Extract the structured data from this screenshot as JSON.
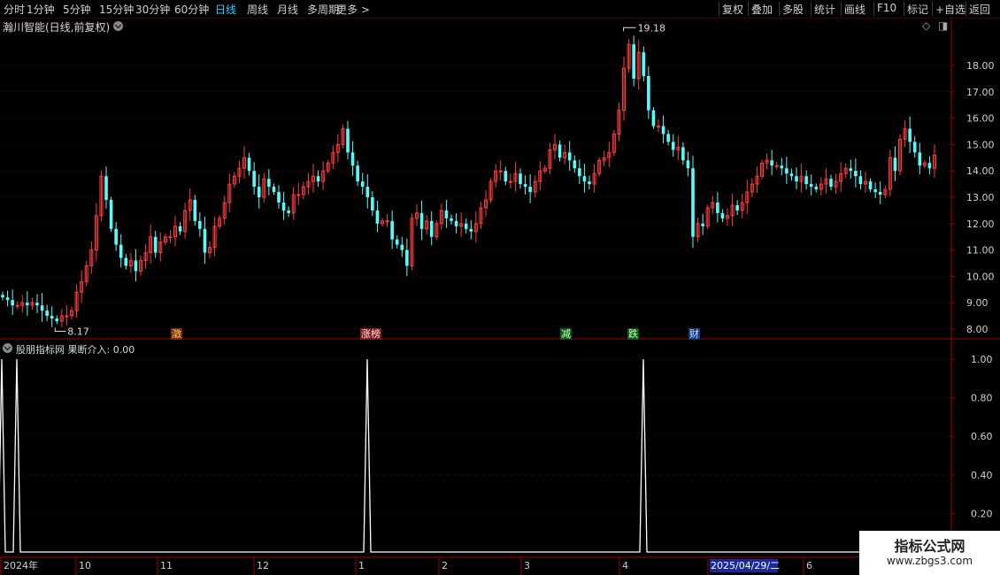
{
  "toolbar": {
    "periods": [
      "分时",
      "1分钟",
      "5分钟",
      "15分钟",
      "30分钟",
      "60分钟",
      "日线",
      "周线",
      "月线",
      "多周期",
      "更多 >"
    ],
    "active_period": "日线",
    "actions": [
      "复权",
      "叠加",
      "多股",
      "统计",
      "画线",
      "F10",
      "标记",
      "+自选",
      "返回"
    ]
  },
  "stock": {
    "title": "瀚川智能(日线,前复权)",
    "high_label": "19.18",
    "low_label": "8.17"
  },
  "price_axis": [
    "18.00",
    "17.00",
    "16.00",
    "15.00",
    "14.00",
    "13.00",
    "12.00",
    "11.00",
    "10.00",
    "9.00",
    "8.00"
  ],
  "indicator": {
    "title": "股朋指标网 果断介入: 0.00",
    "axis": [
      "1.00",
      "0.80",
      "0.60",
      "0.40",
      "0.20"
    ]
  },
  "events": [
    "澂",
    "涨榜",
    "减",
    "跌",
    "财"
  ],
  "date_axis": {
    "labels": [
      "2024年",
      "10",
      "11",
      "12",
      "1",
      "2",
      "3",
      "4",
      "2025/04/29/二",
      "6"
    ]
  },
  "watermark": {
    "line1": "指标公式网",
    "line2": "www.zbgs3.com"
  },
  "colors": {
    "up": "#ff3c3c",
    "down": "#54fcfc",
    "grid": "#5a0000",
    "axis": "#a00000"
  },
  "chart_data": {
    "type": "candlestick",
    "ylim": [
      7.6,
      19.8
    ],
    "closes": [
      9.2,
      9.1,
      8.9,
      8.9,
      9.0,
      8.9,
      9.0,
      8.9,
      8.7,
      8.5,
      8.4,
      8.3,
      8.5,
      8.5,
      8.7,
      9.4,
      9.8,
      10.4,
      11.0,
      12.3,
      13.8,
      12.9,
      11.8,
      11.2,
      10.7,
      10.4,
      10.6,
      10.2,
      10.6,
      10.9,
      11.5,
      10.9,
      11.3,
      11.5,
      11.5,
      11.9,
      11.7,
      12.5,
      12.9,
      12.1,
      11.8,
      10.9,
      11.1,
      11.9,
      12.2,
      12.8,
      13.5,
      13.8,
      14.1,
      14.5,
      14.0,
      13.4,
      13.0,
      13.7,
      13.4,
      13.2,
      12.8,
      12.5,
      12.4,
      13.1,
      13.1,
      13.4,
      13.6,
      13.8,
      13.6,
      14.0,
      14.3,
      14.7,
      15.0,
      15.6,
      14.7,
      14.2,
      13.6,
      13.4,
      13.0,
      12.5,
      12.0,
      12.1,
      12.1,
      11.4,
      11.2,
      11.0,
      10.4,
      12.2,
      12.4,
      11.8,
      12.1,
      11.5,
      12.0,
      12.5,
      12.2,
      12.1,
      11.9,
      12.0,
      11.8,
      11.7,
      12.0,
      12.6,
      12.9,
      13.6,
      14.0,
      14.0,
      13.6,
      13.6,
      13.9,
      13.5,
      13.4,
      13.2,
      13.6,
      14.0,
      14.1,
      14.8,
      15.0,
      14.5,
      14.7,
      14.4,
      14.1,
      13.8,
      13.6,
      13.5,
      13.9,
      14.4,
      14.5,
      14.7,
      15.4,
      16.3,
      17.9,
      18.8,
      17.5,
      18.5,
      17.6,
      16.3,
      15.7,
      15.7,
      15.4,
      15.1,
      14.8,
      14.9,
      14.4,
      14.1,
      11.5,
      12.0,
      11.9,
      12.6,
      12.8,
      12.4,
      12.2,
      12.3,
      12.7,
      12.5,
      12.8,
      13.2,
      13.5,
      13.8,
      14.3,
      14.4,
      14.2,
      14.2,
      14.1,
      13.9,
      13.8,
      13.6,
      13.8,
      13.5,
      13.4,
      13.3,
      13.5,
      13.7,
      13.4,
      13.6,
      13.9,
      14.1,
      14.0,
      13.8,
      13.5,
      13.6,
      13.3,
      13.2,
      13.1,
      13.3,
      14.5,
      14.0,
      15.2,
      15.6,
      15.1,
      14.7,
      14.2,
      14.3,
      14.1,
      14.6
    ],
    "indicator_pulses": [
      2,
      19,
      415,
      727
    ]
  }
}
